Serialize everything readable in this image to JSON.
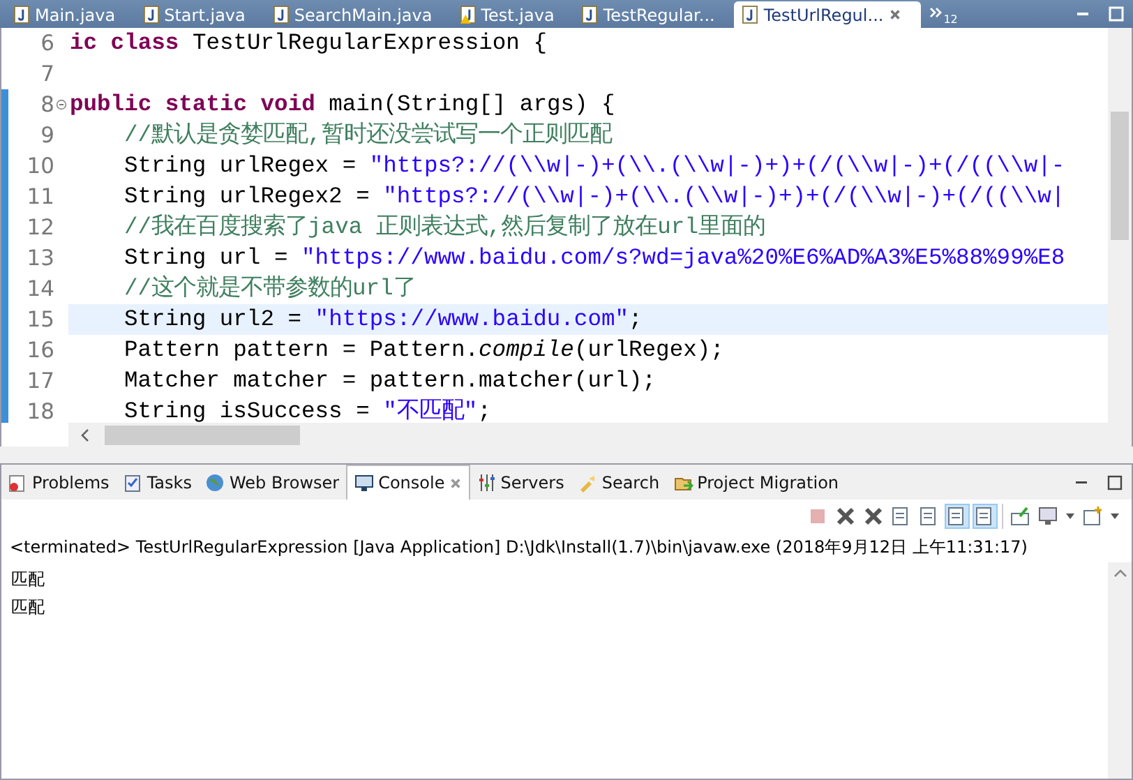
{
  "editor_tabs": [
    {
      "label": "Main.java",
      "selected": false,
      "warning": false
    },
    {
      "label": "Start.java",
      "selected": false,
      "warning": false
    },
    {
      "label": "SearchMain.java",
      "selected": false,
      "warning": false
    },
    {
      "label": "Test.java",
      "selected": false,
      "warning": true
    },
    {
      "label": "TestRegular...",
      "selected": false,
      "warning": false
    },
    {
      "label": "TestUrlRegul...",
      "selected": true,
      "warning": false
    }
  ],
  "overflow_count": "12",
  "editor": {
    "lines": [
      {
        "number": "6",
        "fold": false,
        "current": false,
        "indented": false,
        "tokens": [
          {
            "kind": "kw",
            "text": "ic class "
          },
          {
            "kind": "plain",
            "text": "TestUrlRegularExpression {"
          }
        ]
      },
      {
        "number": "7",
        "fold": false,
        "current": false
      },
      {
        "number": "8",
        "fold": true,
        "current": false,
        "indented": false,
        "tokens": [
          {
            "kind": "kw",
            "text": "public static void "
          },
          {
            "kind": "plain",
            "text": "main(String[] args) {"
          }
        ]
      },
      {
        "number": "9",
        "fold": false,
        "current": false,
        "indented": true,
        "tokens": [
          {
            "kind": "comment",
            "text": "//默认是贪婪匹配,暂时还没尝试写一个正则匹配"
          }
        ]
      },
      {
        "number": "10",
        "fold": false,
        "current": false,
        "indented": true,
        "tokens": [
          {
            "kind": "plain",
            "text": "String urlRegex = "
          },
          {
            "kind": "string",
            "text": "\"https?://(\\\\w|-)+(\\\\.(\\\\w|-)+)+(/(\\\\w|-)+(/((\\\\w|-"
          }
        ]
      },
      {
        "number": "11",
        "fold": false,
        "current": false,
        "indented": true,
        "tokens": [
          {
            "kind": "plain",
            "text": "String urlRegex2 = "
          },
          {
            "kind": "string",
            "text": "\"https?://(\\\\w|-)+(\\\\.(\\\\w|-)+)+(/(\\\\w|-)+(/((\\\\w|"
          }
        ]
      },
      {
        "number": "12",
        "fold": false,
        "current": false,
        "indented": true,
        "tokens": [
          {
            "kind": "comment",
            "text": "//我在百度搜索了java 正则表达式,然后复制了放在url里面的"
          }
        ]
      },
      {
        "number": "13",
        "fold": false,
        "current": false,
        "indented": true,
        "tokens": [
          {
            "kind": "plain",
            "text": "String url = "
          },
          {
            "kind": "string",
            "text": "\"https://www.baidu.com/s?wd=java%20%E6%AD%A3%E5%88%99%E8"
          }
        ]
      },
      {
        "number": "14",
        "fold": false,
        "current": false,
        "indented": true,
        "tokens": [
          {
            "kind": "comment",
            "text": "//这个就是不带参数的url了"
          }
        ]
      },
      {
        "number": "15",
        "fold": false,
        "current": true,
        "indented": true,
        "tokens": [
          {
            "kind": "plain",
            "text": "String url2 = "
          },
          {
            "kind": "string",
            "text": "\"https://www.baidu.com\""
          },
          {
            "kind": "plain",
            "text": ";"
          }
        ]
      },
      {
        "number": "16",
        "fold": false,
        "current": false,
        "indented": true,
        "tokens": [
          {
            "kind": "plain",
            "text": "Pattern pattern = Pattern."
          },
          {
            "kind": "italic",
            "text": "compile"
          },
          {
            "kind": "plain",
            "text": "(urlRegex);"
          }
        ]
      },
      {
        "number": "17",
        "fold": false,
        "current": false,
        "indented": true,
        "tokens": [
          {
            "kind": "plain",
            "text": "Matcher matcher = pattern.matcher(url);"
          }
        ]
      },
      {
        "number": "18",
        "fold": false,
        "current": false,
        "indented": true,
        "tokens": [
          {
            "kind": "plain",
            "text": "String isSuccess = "
          },
          {
            "kind": "string",
            "text": "\"不匹配\""
          },
          {
            "kind": "plain",
            "text": ";"
          }
        ]
      }
    ]
  },
  "console_tabs": [
    {
      "label": "Problems",
      "selected": false,
      "kind": "problems"
    },
    {
      "label": "Tasks",
      "selected": false,
      "kind": "tasks"
    },
    {
      "label": "Web Browser",
      "selected": false,
      "kind": "globe"
    },
    {
      "label": "Console",
      "selected": true,
      "kind": "console"
    },
    {
      "label": "Servers",
      "selected": false,
      "kind": "servers"
    },
    {
      "label": "Search",
      "selected": false,
      "kind": "search"
    },
    {
      "label": "Project Migration",
      "selected": false,
      "kind": "migration"
    }
  ],
  "console": {
    "status": "<terminated> TestUrlRegularExpression [Java Application] D:\\Jdk\\Install(1.7)\\bin\\javaw.exe (2018年9月12日 上午11:31:17)",
    "output": [
      "匹配",
      "匹配"
    ]
  }
}
